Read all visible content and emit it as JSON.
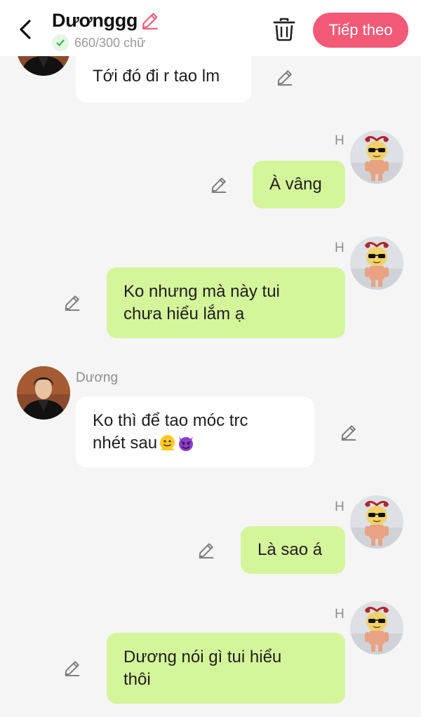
{
  "header": {
    "title": "Dươnggg",
    "word_count": "660/300 chữ",
    "next_label": "Tiếp theo"
  },
  "messages": [
    {
      "side": "in",
      "sender": "",
      "text": "Tới đó đi r tao lm"
    },
    {
      "side": "out",
      "sender": "H",
      "text": "À vâng"
    },
    {
      "side": "out",
      "sender": "H",
      "text_lines": [
        "Ko nhưng mà này tui",
        "chưa hiểu lắm ạ"
      ]
    },
    {
      "side": "in",
      "sender": "Dương",
      "text_lines": [
        "Ko thì để tao móc trc",
        "nhét sau"
      ],
      "emojis": [
        "melting-face",
        "smiling-devil"
      ]
    },
    {
      "side": "out",
      "sender": "H",
      "text": "Là sao á"
    },
    {
      "side": "out",
      "sender": "H",
      "text_lines": [
        "Dương nói gì tui hiểu",
        "thôi"
      ]
    }
  ],
  "colors": {
    "accent": "#f25a78",
    "outgoing_bubble": "#d5f59b",
    "incoming_bubble": "#ffffff",
    "background": "#f5f5f5"
  }
}
